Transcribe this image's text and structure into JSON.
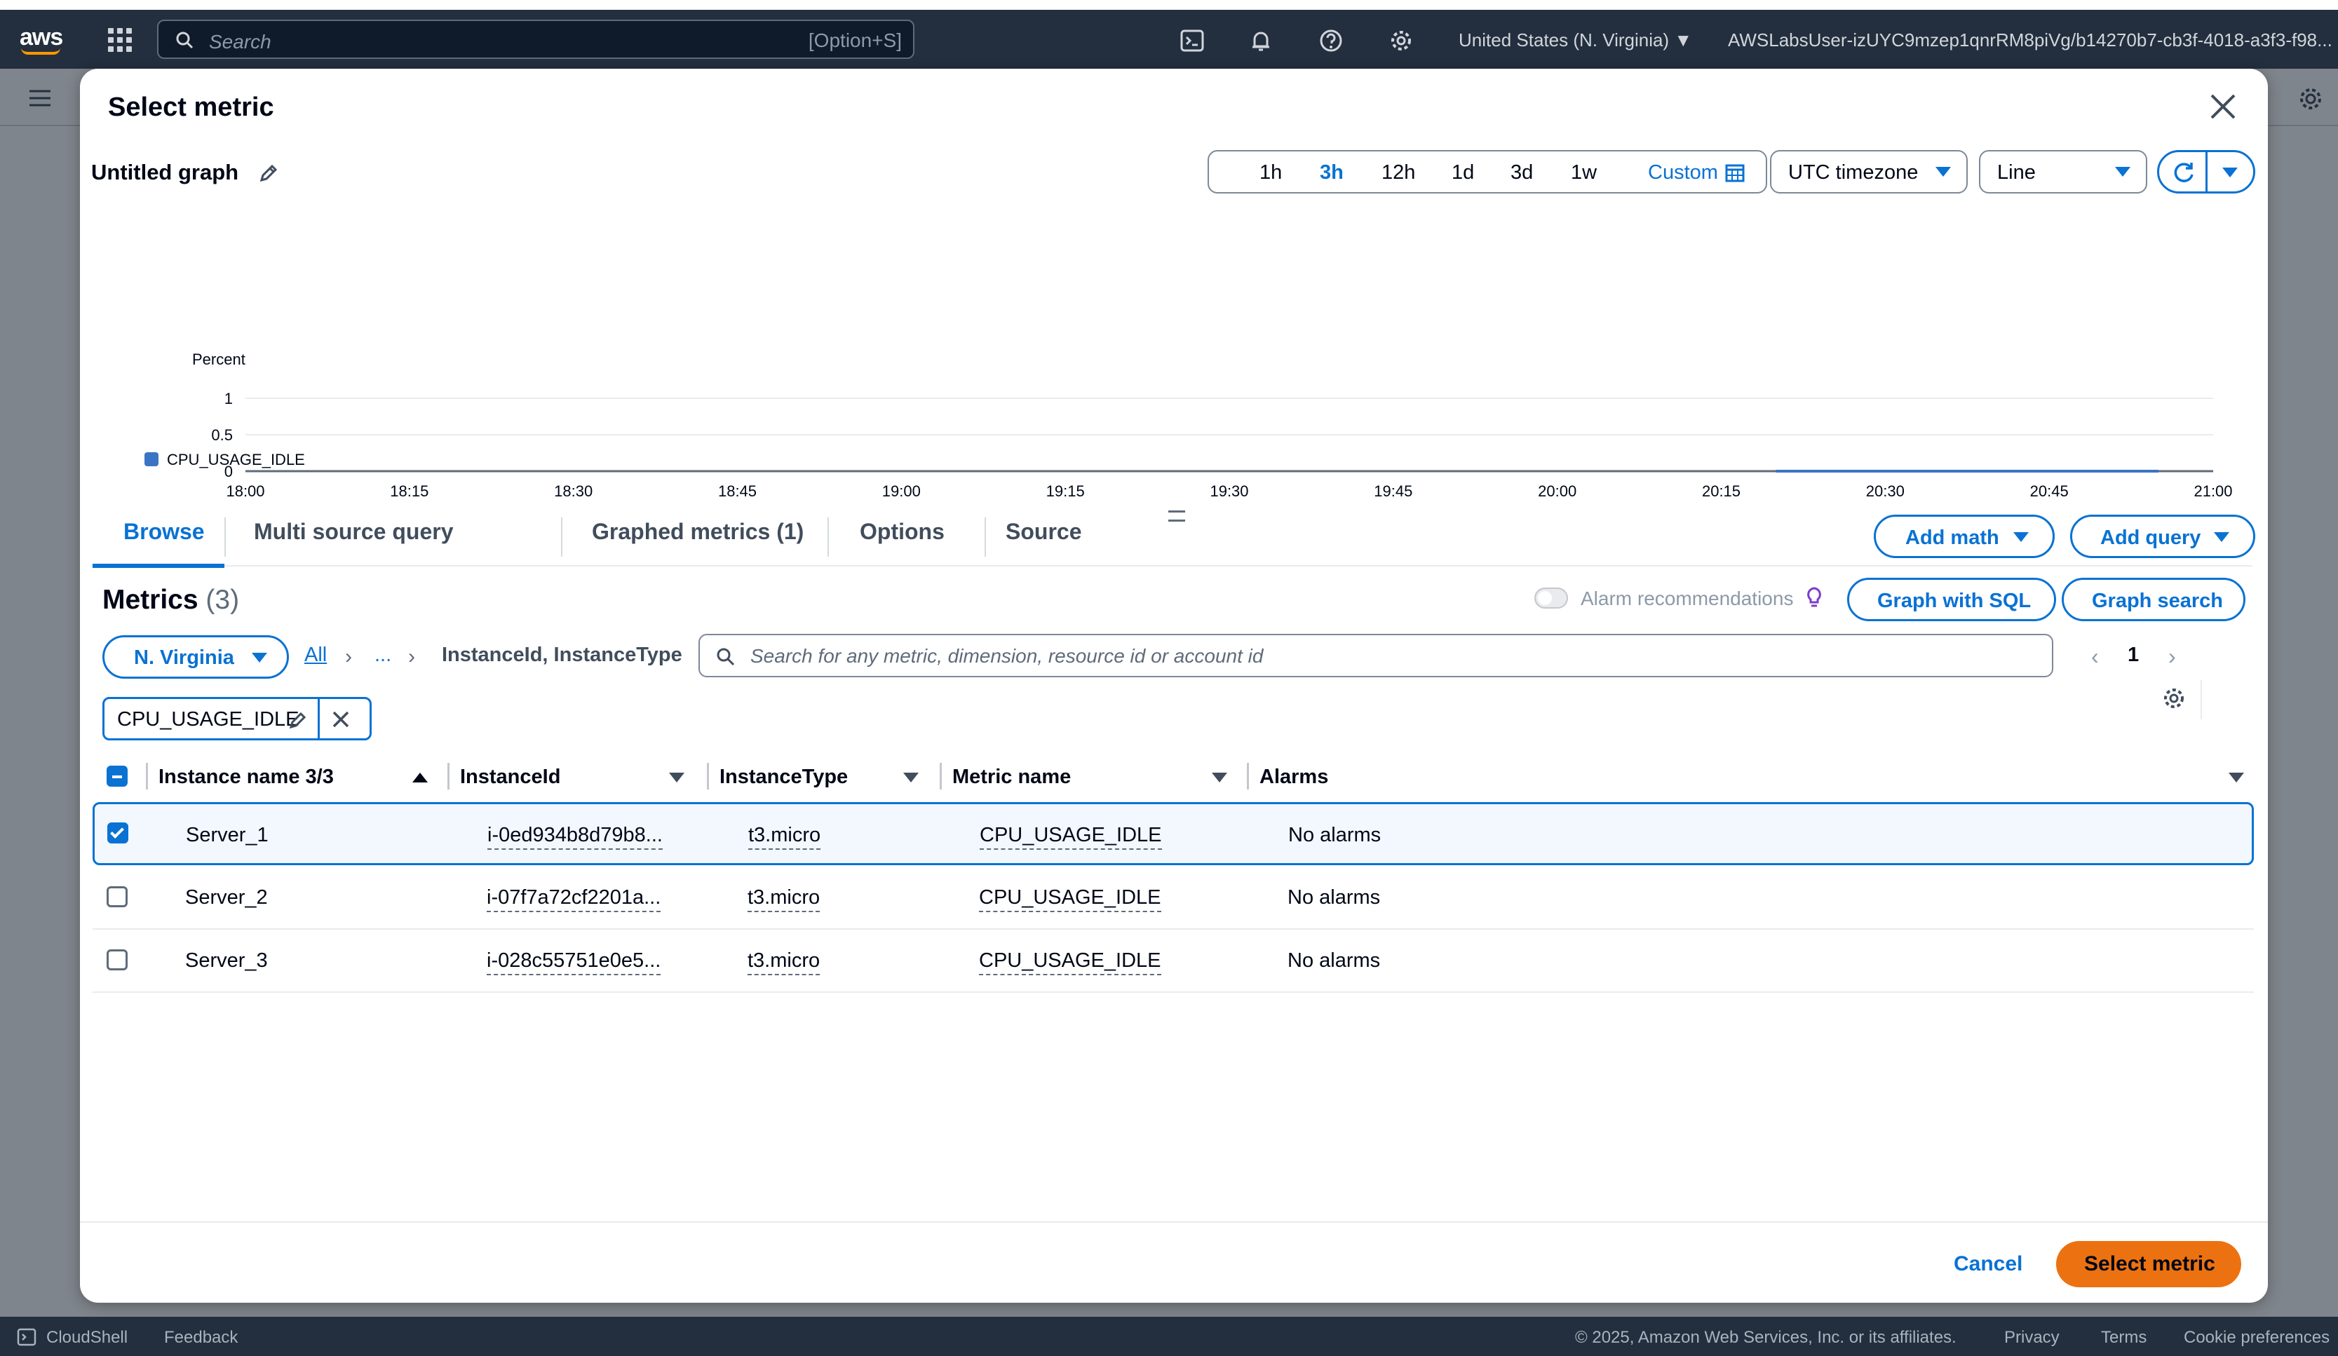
{
  "topnav": {
    "logo": "aws",
    "search_placeholder": "Search",
    "search_shortcut": "[Option+S]",
    "region": "United States (N. Virginia)",
    "user": "AWSLabsUser-izUYC9mzep1qnrRM8piVg/b14270b7-cb3f-4018-a3f3-f98..."
  },
  "modal": {
    "title": "Select metric",
    "graph_title": "Untitled graph",
    "time_ranges": [
      "1h",
      "3h",
      "12h",
      "1d",
      "3d",
      "1w",
      "Custom"
    ],
    "active_range": "3h",
    "timezone": "UTC timezone",
    "chart_type": "Line"
  },
  "chart_data": {
    "type": "line",
    "ylabel": "Percent",
    "yticks": [
      "1",
      "0.5",
      "0"
    ],
    "ylim": [
      0,
      1
    ],
    "xticks": [
      "18:00",
      "18:15",
      "18:30",
      "18:45",
      "19:00",
      "19:15",
      "19:30",
      "19:45",
      "20:00",
      "20:15",
      "20:30",
      "20:45",
      "21:00"
    ],
    "series": [
      {
        "name": "CPU_USAGE_IDLE",
        "color": "#3b74c4",
        "x_start": "20:20",
        "x_end": "20:55",
        "value": 0
      }
    ],
    "grid": true,
    "legend": "bottom-left"
  },
  "tabs": {
    "browse": "Browse",
    "multi": "Multi source query",
    "graphed": "Graphed metrics (1)",
    "options": "Options",
    "source": "Source"
  },
  "actions": {
    "add_math": "Add math",
    "add_query": "Add query",
    "graph_sql": "Graph with SQL",
    "graph_search": "Graph search"
  },
  "metrics": {
    "title": "Metrics",
    "count": "(3)",
    "alarm_rec": "Alarm recommendations",
    "region": "N. Virginia",
    "bc_all": "All",
    "bc_dots": "...",
    "bc_current": "InstanceId, InstanceType",
    "search_placeholder": "Search for any metric, dimension, resource id or account id",
    "page": "1",
    "token": "CPU_USAGE_IDLE"
  },
  "table": {
    "headers": {
      "name": "Instance name 3/3",
      "id": "InstanceId",
      "type": "InstanceType",
      "metric": "Metric name",
      "alarms": "Alarms"
    },
    "rows": [
      {
        "name": "Server_1",
        "id": "i-0ed934b8d79b8...",
        "type": "t3.micro",
        "metric": "CPU_USAGE_IDLE",
        "alarms": "No alarms",
        "checked": true
      },
      {
        "name": "Server_2",
        "id": "i-07f7a72cf2201a...",
        "type": "t3.micro",
        "metric": "CPU_USAGE_IDLE",
        "alarms": "No alarms",
        "checked": false
      },
      {
        "name": "Server_3",
        "id": "i-028c55751e0e5...",
        "type": "t3.micro",
        "metric": "CPU_USAGE_IDLE",
        "alarms": "No alarms",
        "checked": false
      }
    ]
  },
  "footer_modal": {
    "cancel": "Cancel",
    "select": "Select metric"
  },
  "footer": {
    "cloudshell": "CloudShell",
    "feedback": "Feedback",
    "copyright": "© 2025, Amazon Web Services, Inc. or its affiliates.",
    "privacy": "Privacy",
    "terms": "Terms",
    "cookies": "Cookie preferences"
  }
}
